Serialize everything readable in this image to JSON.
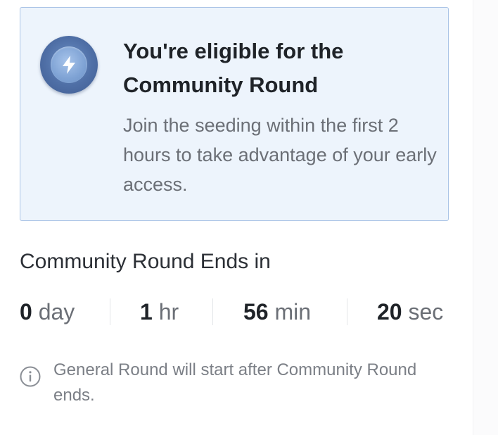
{
  "eligibility_card": {
    "icon": "lightning-bolt-icon",
    "title": "You're eligible for the Community Round",
    "description": "Join the seeding within the first 2 hours to take advantage of your early access."
  },
  "countdown": {
    "label": "Community Round Ends in",
    "days": {
      "value": "0",
      "unit": "day"
    },
    "hours": {
      "value": "1",
      "unit": "hr"
    },
    "minutes": {
      "value": "56",
      "unit": "min"
    },
    "seconds": {
      "value": "20",
      "unit": "sec"
    }
  },
  "notice": {
    "icon": "info-icon",
    "text": "General Round will start after Community Round ends."
  },
  "colors": {
    "card_background": "#edf4fc",
    "card_border": "#a9c3e6",
    "badge": "#4f6fa6",
    "muted_text": "#6b6f76"
  }
}
